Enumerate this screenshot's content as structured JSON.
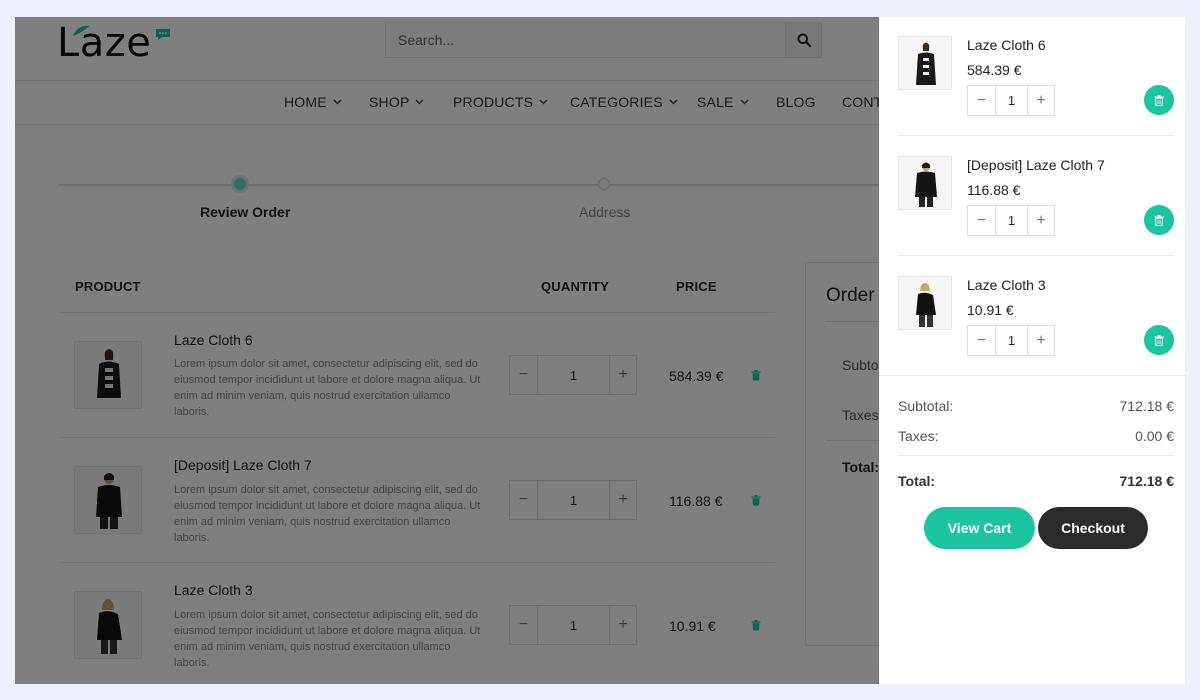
{
  "header": {
    "logo_text": "Laze",
    "search": {
      "placeholder": "Search..."
    },
    "nav": [
      {
        "label": "HOME",
        "has_dropdown": true
      },
      {
        "label": "SHOP",
        "has_dropdown": true
      },
      {
        "label": "PRODUCTS",
        "has_dropdown": true
      },
      {
        "label": "CATEGORIES",
        "has_dropdown": true
      },
      {
        "label": "SALE",
        "has_dropdown": true
      },
      {
        "label": "BLOG",
        "has_dropdown": false
      },
      {
        "label": "CONT",
        "has_dropdown": false
      }
    ]
  },
  "stepper": {
    "steps": [
      {
        "label": "Review Order",
        "active": true
      },
      {
        "label": "Address",
        "active": false
      }
    ]
  },
  "cart_table": {
    "headers": {
      "product": "PRODUCT",
      "quantity": "QUANTITY",
      "price": "PRICE"
    },
    "rows": [
      {
        "name": "Laze Cloth 6",
        "description": "Lorem ipsum dolor sit amet, consectetur adipiscing elit, sed do eiusmod tempor incididunt ut labore et dolore magna aliqua. Ut enim ad minim veniam, quis nostrud exercitation ullamco laboris.",
        "quantity": "1",
        "price": "584.39 €"
      },
      {
        "name": "[Deposit] Laze Cloth 7",
        "description": "Lorem ipsum dolor sit amet, consectetur adipiscing elit, sed do eiusmod tempor incididunt ut labore et dolore magna aliqua. Ut enim ad minim veniam, quis nostrud exercitation ullamco laboris.",
        "quantity": "1",
        "price": "116.88 €"
      },
      {
        "name": "Laze Cloth 3",
        "description": "Lorem ipsum dolor sit amet, consectetur adipiscing elit, sed do eiusmod tempor incididunt ut labore et dolore magna aliqua. Ut enim ad minim veniam, quis nostrud exercitation ullamco laboris.",
        "quantity": "1",
        "price": "10.91 €"
      }
    ]
  },
  "order_box": {
    "title": "Order T",
    "subtotal_label": "Subtot",
    "taxes_label": "Taxes:",
    "total_label": "Total:"
  },
  "side_cart": {
    "items": [
      {
        "name": "Laze Cloth 6",
        "price": "584.39 €",
        "quantity": "1"
      },
      {
        "name": "[Deposit] Laze Cloth 7",
        "price": "116.88 €",
        "quantity": "1"
      },
      {
        "name": "Laze Cloth 3",
        "price": "10.91 €",
        "quantity": "1"
      }
    ],
    "subtotal_label": "Subtotal:",
    "subtotal_value": "712.18 €",
    "taxes_label": "Taxes:",
    "taxes_value": "0.00 €",
    "total_label": "Total:",
    "total_value": "712.18 €",
    "view_cart_label": "View Cart",
    "checkout_label": "Checkout"
  },
  "colors": {
    "accent": "#1dc4a0",
    "dark_button": "#2b2b2b",
    "overlay": "rgba(0,0,0,0.5)",
    "page_background": "#eef1fb"
  }
}
